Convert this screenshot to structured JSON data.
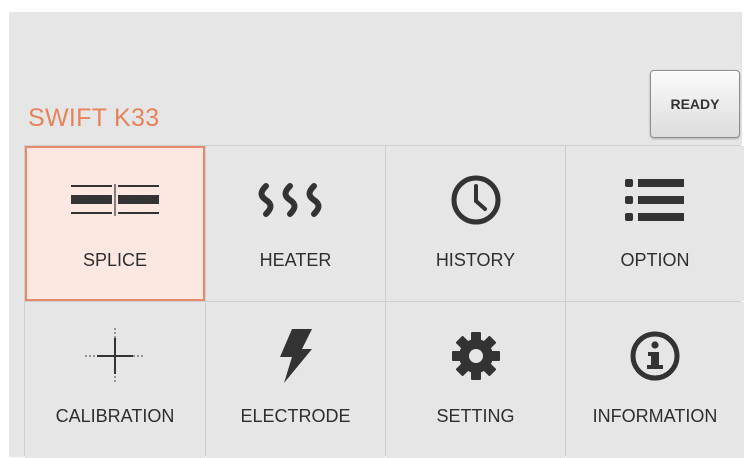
{
  "header": {
    "device_title": "SWIFT K33",
    "ready_label": "READY"
  },
  "menu": {
    "items": [
      {
        "label": "SPLICE",
        "icon": "splice-icon",
        "active": true
      },
      {
        "label": "HEATER",
        "icon": "heater-icon"
      },
      {
        "label": "HISTORY",
        "icon": "clock-icon"
      },
      {
        "label": "OPTION",
        "icon": "list-icon"
      },
      {
        "label": "CALIBRATION",
        "icon": "crosshair-icon"
      },
      {
        "label": "ELECTRODE",
        "icon": "lightning-bolt-icon"
      },
      {
        "label": "SETTING",
        "icon": "gear-icon"
      },
      {
        "label": "INFORMATION",
        "icon": "info-icon"
      }
    ]
  },
  "colors": {
    "accent": "#e8825a",
    "active_fill": "#fde8e1",
    "background": "#e6e6e6"
  }
}
